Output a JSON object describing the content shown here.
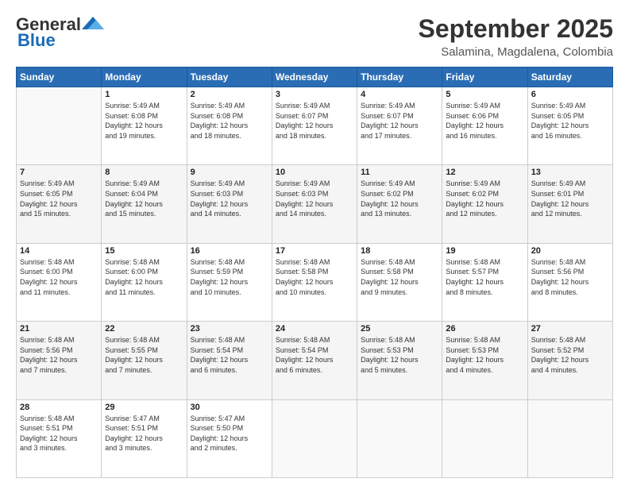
{
  "header": {
    "logo_general": "General",
    "logo_blue": "Blue",
    "month": "September 2025",
    "location": "Salamina, Magdalena, Colombia"
  },
  "days_of_week": [
    "Sunday",
    "Monday",
    "Tuesday",
    "Wednesday",
    "Thursday",
    "Friday",
    "Saturday"
  ],
  "weeks": [
    [
      {
        "day": "",
        "info": ""
      },
      {
        "day": "1",
        "info": "Sunrise: 5:49 AM\nSunset: 6:08 PM\nDaylight: 12 hours\nand 19 minutes."
      },
      {
        "day": "2",
        "info": "Sunrise: 5:49 AM\nSunset: 6:08 PM\nDaylight: 12 hours\nand 18 minutes."
      },
      {
        "day": "3",
        "info": "Sunrise: 5:49 AM\nSunset: 6:07 PM\nDaylight: 12 hours\nand 18 minutes."
      },
      {
        "day": "4",
        "info": "Sunrise: 5:49 AM\nSunset: 6:07 PM\nDaylight: 12 hours\nand 17 minutes."
      },
      {
        "day": "5",
        "info": "Sunrise: 5:49 AM\nSunset: 6:06 PM\nDaylight: 12 hours\nand 16 minutes."
      },
      {
        "day": "6",
        "info": "Sunrise: 5:49 AM\nSunset: 6:05 PM\nDaylight: 12 hours\nand 16 minutes."
      }
    ],
    [
      {
        "day": "7",
        "info": "Sunrise: 5:49 AM\nSunset: 6:05 PM\nDaylight: 12 hours\nand 15 minutes."
      },
      {
        "day": "8",
        "info": "Sunrise: 5:49 AM\nSunset: 6:04 PM\nDaylight: 12 hours\nand 15 minutes."
      },
      {
        "day": "9",
        "info": "Sunrise: 5:49 AM\nSunset: 6:03 PM\nDaylight: 12 hours\nand 14 minutes."
      },
      {
        "day": "10",
        "info": "Sunrise: 5:49 AM\nSunset: 6:03 PM\nDaylight: 12 hours\nand 14 minutes."
      },
      {
        "day": "11",
        "info": "Sunrise: 5:49 AM\nSunset: 6:02 PM\nDaylight: 12 hours\nand 13 minutes."
      },
      {
        "day": "12",
        "info": "Sunrise: 5:49 AM\nSunset: 6:02 PM\nDaylight: 12 hours\nand 12 minutes."
      },
      {
        "day": "13",
        "info": "Sunrise: 5:49 AM\nSunset: 6:01 PM\nDaylight: 12 hours\nand 12 minutes."
      }
    ],
    [
      {
        "day": "14",
        "info": "Sunrise: 5:48 AM\nSunset: 6:00 PM\nDaylight: 12 hours\nand 11 minutes."
      },
      {
        "day": "15",
        "info": "Sunrise: 5:48 AM\nSunset: 6:00 PM\nDaylight: 12 hours\nand 11 minutes."
      },
      {
        "day": "16",
        "info": "Sunrise: 5:48 AM\nSunset: 5:59 PM\nDaylight: 12 hours\nand 10 minutes."
      },
      {
        "day": "17",
        "info": "Sunrise: 5:48 AM\nSunset: 5:58 PM\nDaylight: 12 hours\nand 10 minutes."
      },
      {
        "day": "18",
        "info": "Sunrise: 5:48 AM\nSunset: 5:58 PM\nDaylight: 12 hours\nand 9 minutes."
      },
      {
        "day": "19",
        "info": "Sunrise: 5:48 AM\nSunset: 5:57 PM\nDaylight: 12 hours\nand 8 minutes."
      },
      {
        "day": "20",
        "info": "Sunrise: 5:48 AM\nSunset: 5:56 PM\nDaylight: 12 hours\nand 8 minutes."
      }
    ],
    [
      {
        "day": "21",
        "info": "Sunrise: 5:48 AM\nSunset: 5:56 PM\nDaylight: 12 hours\nand 7 minutes."
      },
      {
        "day": "22",
        "info": "Sunrise: 5:48 AM\nSunset: 5:55 PM\nDaylight: 12 hours\nand 7 minutes."
      },
      {
        "day": "23",
        "info": "Sunrise: 5:48 AM\nSunset: 5:54 PM\nDaylight: 12 hours\nand 6 minutes."
      },
      {
        "day": "24",
        "info": "Sunrise: 5:48 AM\nSunset: 5:54 PM\nDaylight: 12 hours\nand 6 minutes."
      },
      {
        "day": "25",
        "info": "Sunrise: 5:48 AM\nSunset: 5:53 PM\nDaylight: 12 hours\nand 5 minutes."
      },
      {
        "day": "26",
        "info": "Sunrise: 5:48 AM\nSunset: 5:53 PM\nDaylight: 12 hours\nand 4 minutes."
      },
      {
        "day": "27",
        "info": "Sunrise: 5:48 AM\nSunset: 5:52 PM\nDaylight: 12 hours\nand 4 minutes."
      }
    ],
    [
      {
        "day": "28",
        "info": "Sunrise: 5:48 AM\nSunset: 5:51 PM\nDaylight: 12 hours\nand 3 minutes."
      },
      {
        "day": "29",
        "info": "Sunrise: 5:47 AM\nSunset: 5:51 PM\nDaylight: 12 hours\nand 3 minutes."
      },
      {
        "day": "30",
        "info": "Sunrise: 5:47 AM\nSunset: 5:50 PM\nDaylight: 12 hours\nand 2 minutes."
      },
      {
        "day": "",
        "info": ""
      },
      {
        "day": "",
        "info": ""
      },
      {
        "day": "",
        "info": ""
      },
      {
        "day": "",
        "info": ""
      }
    ]
  ]
}
